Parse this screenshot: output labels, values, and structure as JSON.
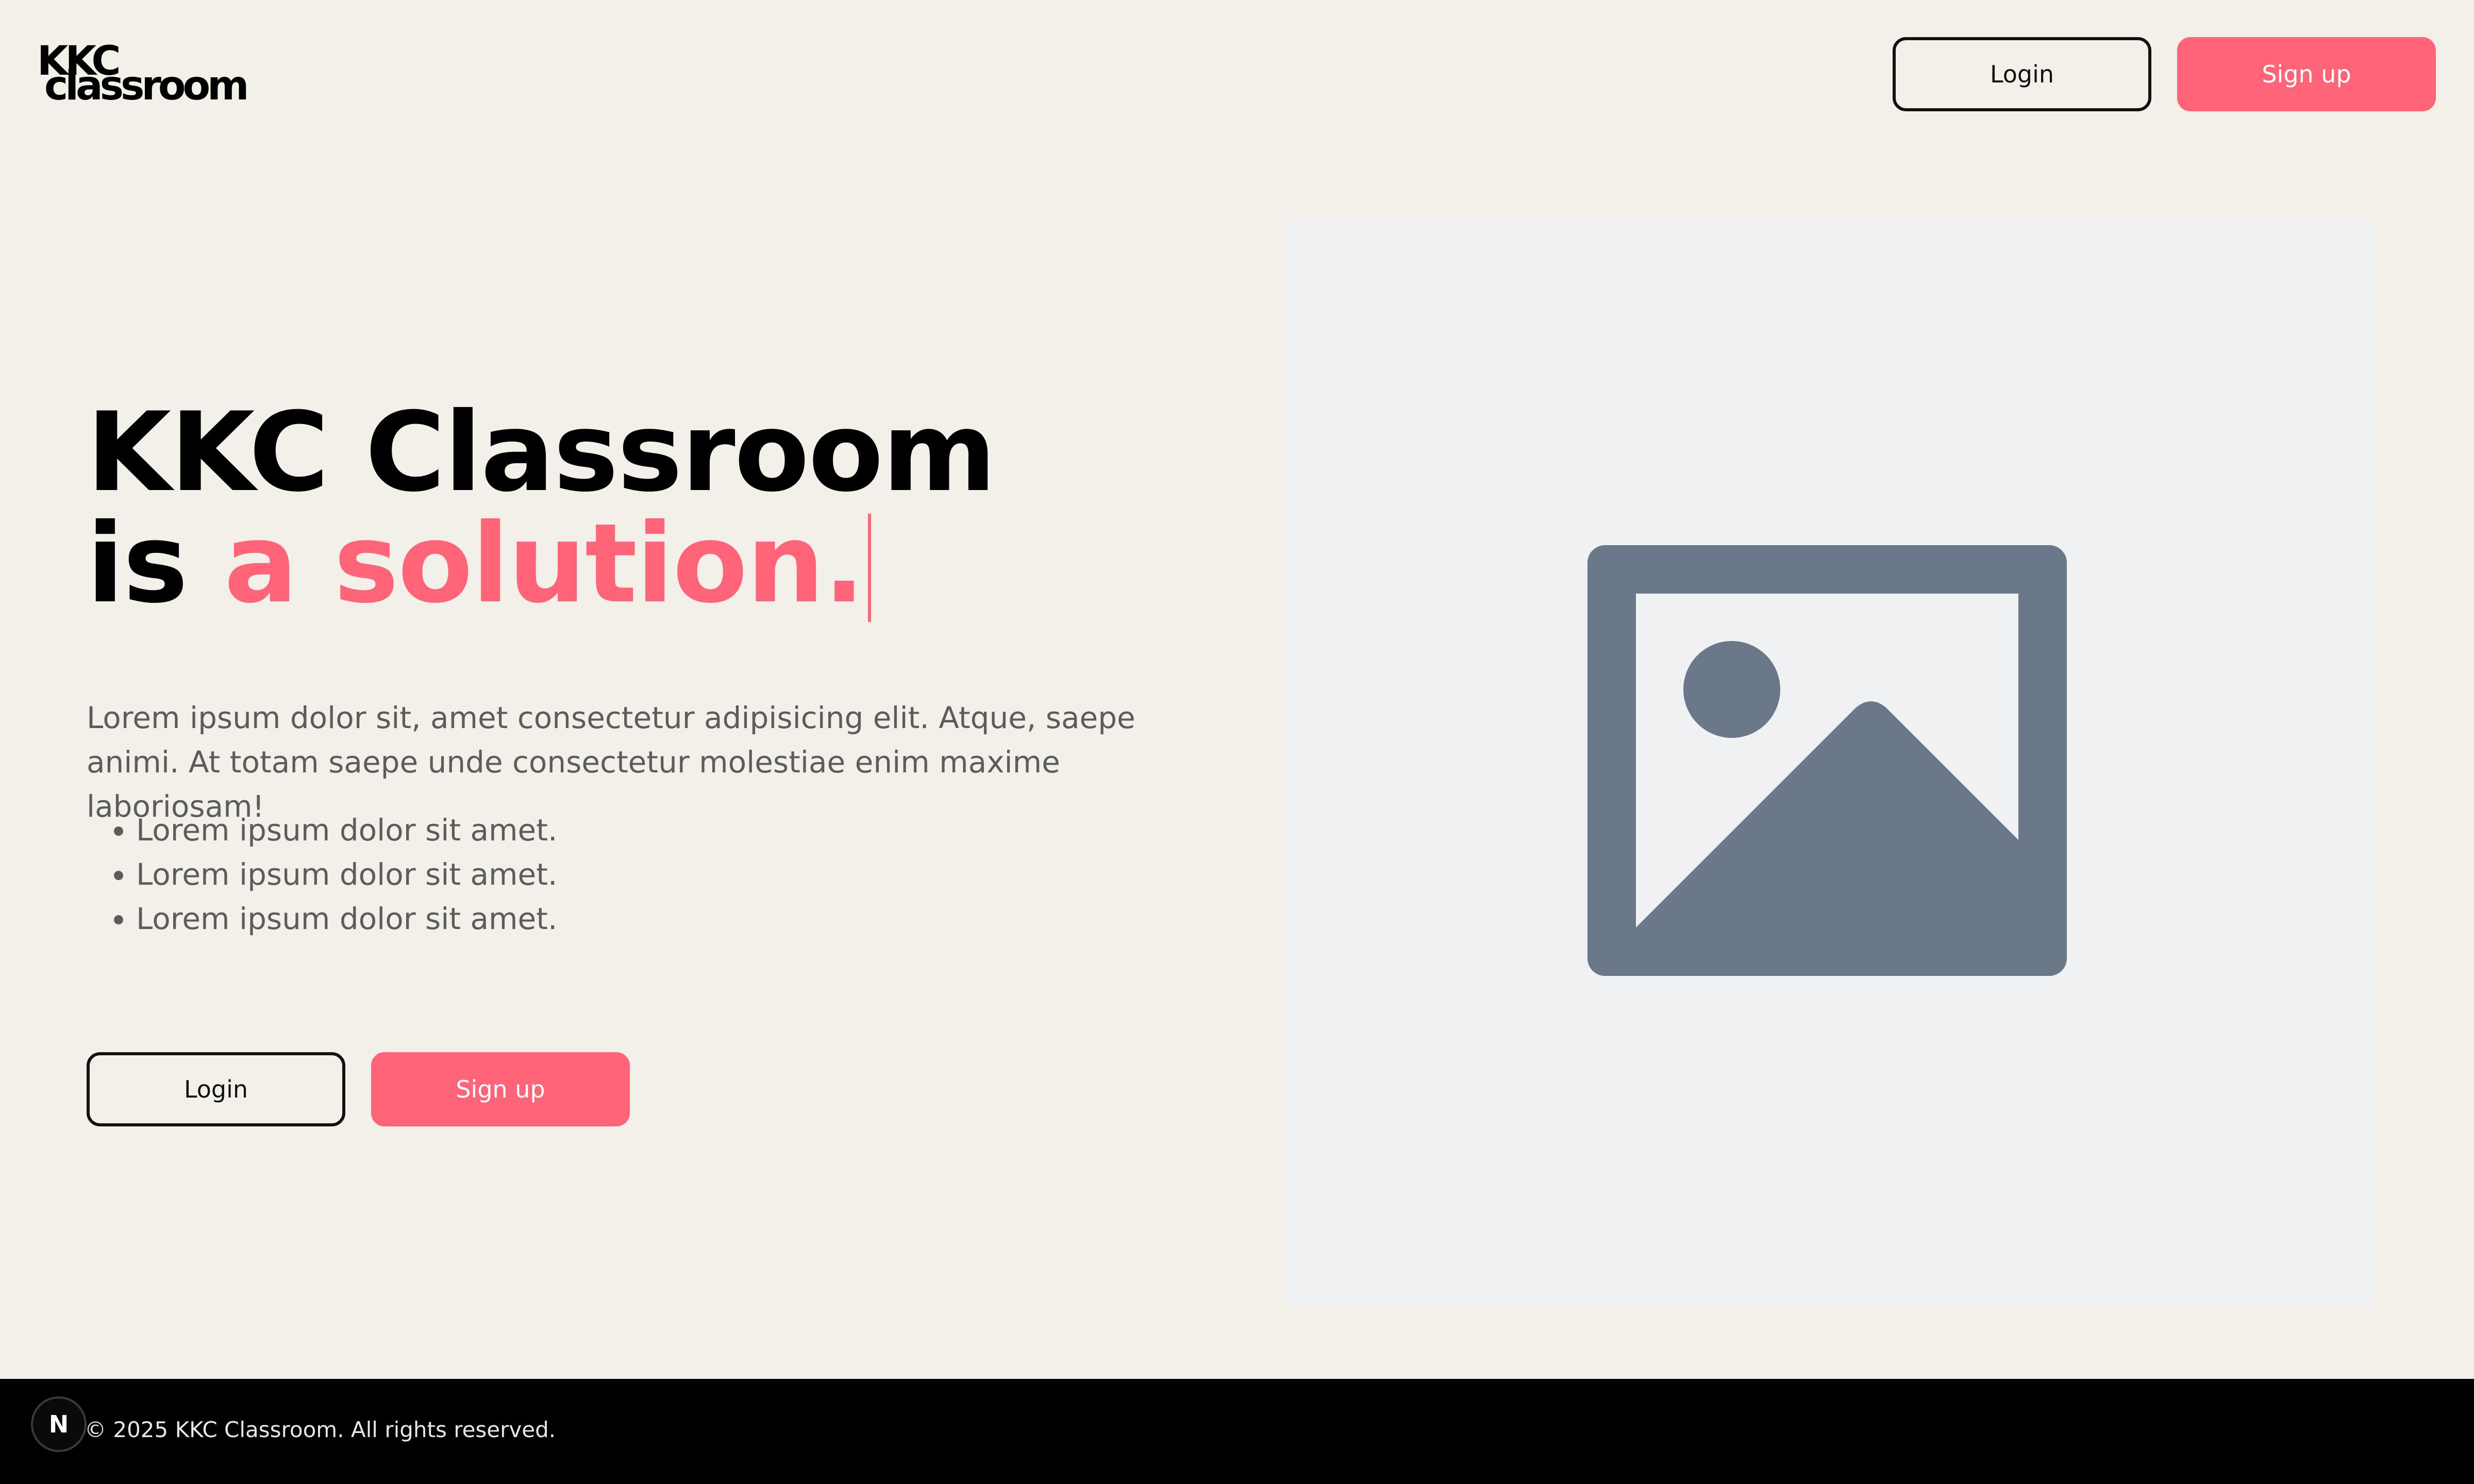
{
  "header": {
    "logo_line1": "KKC",
    "logo_line2": "classroom",
    "login_label": "Login",
    "signup_label": "Sign up"
  },
  "hero": {
    "title_line1": "KKC Classroom",
    "title_prefix": "is",
    "title_accent": "a solution.",
    "description": "Lorem ipsum dolor sit, amet consectetur adipisicing elit. Atque, saepe animi. At totam saepe unde consectetur molestiae enim maxime laboriosam!",
    "bullets": [
      "Lorem ipsum dolor sit amet.",
      "Lorem ipsum dolor sit amet.",
      "Lorem ipsum dolor sit amet."
    ],
    "login_label": "Login",
    "signup_label": "Sign up",
    "image_icon": "image-placeholder-icon"
  },
  "footer": {
    "copyright": "© 2025 KKC Classroom. All rights reserved.",
    "badge_letter": "N"
  },
  "colors": {
    "accent": "#ff6479",
    "background": "#f3f0ea",
    "placeholder_bg": "#eff1f3",
    "placeholder_icon": "#6b7889",
    "footer_bg": "#000000"
  }
}
